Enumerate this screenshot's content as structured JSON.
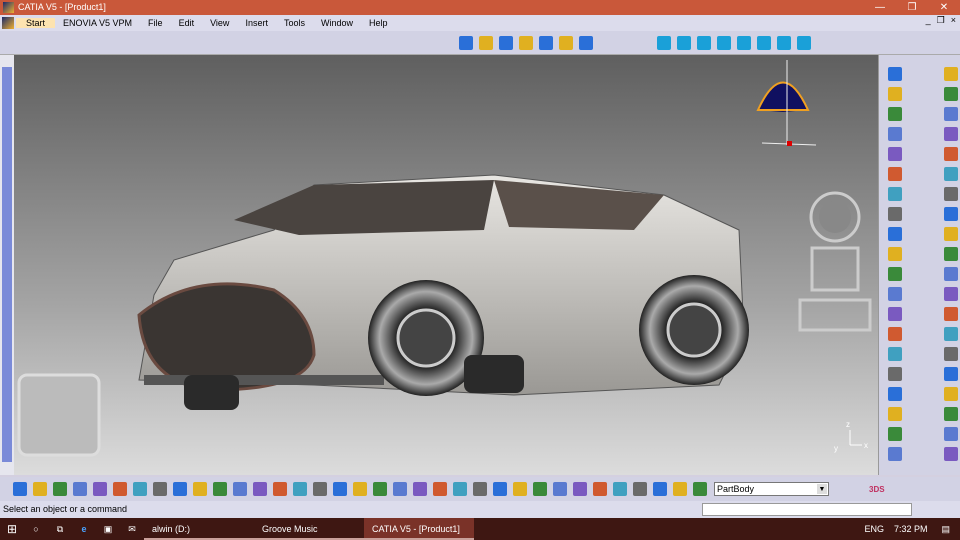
{
  "window": {
    "title": "CATIA V5 - [Product1]",
    "controls": [
      "—",
      "❐",
      "✕"
    ]
  },
  "menu": [
    "Start",
    "ENOVIA V5 VPM",
    "File",
    "Edit",
    "View",
    "Insert",
    "Tools",
    "Window",
    "Help"
  ],
  "mdi_controls": [
    "_",
    "❐",
    "×"
  ],
  "top_toolbar": {
    "icons_left": [
      "cylinder-icon",
      "cylinder-yellow-icon",
      "cylinder-blue-icon",
      "cylinder-stack-icon",
      "cylinder-grid-icon",
      "cylinder-multi-icon",
      "help-icon"
    ],
    "icons_right": [
      "cube-view-icon",
      "front-view-icon",
      "back-view-icon",
      "left-view-icon",
      "right-view-icon",
      "top-view-icon",
      "bottom-view-icon",
      "iso-view-icon"
    ]
  },
  "right_toolbar": {
    "count_col1": 20,
    "count_col2": 20
  },
  "bottom_toolbar": {
    "icons": [
      "new-icon",
      "open-icon",
      "save-icon",
      "print-icon",
      "cut-icon",
      "copy-icon",
      "paste-icon",
      "undo-icon",
      "redo-icon",
      "whats-this-icon",
      "formula-icon",
      "comment-icon",
      "bulb-icon",
      "table-icon",
      "tree-icon",
      "component-icon",
      "catalog-icon",
      "update-icon",
      "measure-icon",
      "inertia-icon",
      "bottle-icon",
      "camera-icon",
      "fly-icon",
      "pan-icon",
      "axis-icon",
      "spec-icon",
      "grid-icon",
      "normal-view-icon",
      "cube-icon",
      "hide-show-icon",
      "swap-icon",
      "tree-expand-icon",
      "render-icon",
      "layer-icon",
      "shading-icon"
    ],
    "part_body": "PartBody"
  },
  "status": {
    "text": "Select an object or a command"
  },
  "compass_axis": {
    "z": "z",
    "y": "y",
    "x": "x"
  },
  "taskbar": {
    "items": [
      "alwin (D:)",
      "Groove Music",
      "CATIA V5 - [Product1]"
    ],
    "lang": "ENG",
    "time": "7:32 PM"
  },
  "colors": {
    "title": "#c9583a",
    "taskbar": "#3e1712"
  }
}
